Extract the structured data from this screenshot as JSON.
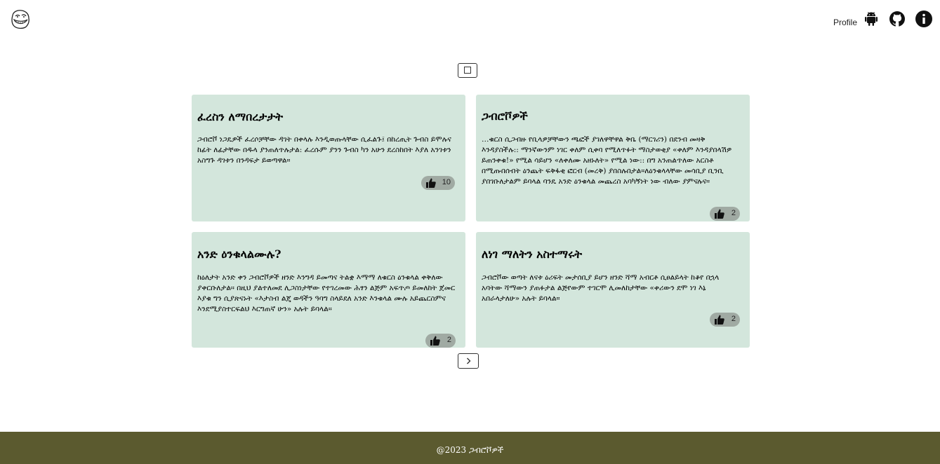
{
  "header": {
    "logo_icon": "trollface-logo-icon",
    "profile_label": "Profile",
    "icons": [
      "android-icon",
      "github-icon",
      "info-icon"
    ]
  },
  "toolbar": {
    "icon": "square-icon"
  },
  "posts": [
    {
      "title": "ፈረስን ለማበረታታት",
      "body": "ጋብሮቮ ነጋዴዎች ፈረሶቻቸው ዳገት በቀላሉ እንዲወጡላቸው ሲፈልጉ፤ በከረጢት ጉብስ ይሞሉና ከፊት ለፊታቸው በዱላ ያንጠለጥሉታል: ፈረሱም ያንን ጉብስ ካን አሁን ደረስከበት እያለ አንገቱን አስግጉ ዳገቱን በንዳፍታ ይወጣዋል።",
      "likes": "10"
    },
    {
      "title": "ጋብሮቮዎች",
      "body": "…ቁርስ ሲጋብዙ የቢላዎቻቸውን ጫፎች ያገለዋቸዋል ቅቤ (ማርገሪን) በደንብ መዛቅ እንዳያስችሉ:: ማንኛውንም ነገር ቀለም ሲቀባ የሚለጥፉት ማስታወቂያ «ቀለም እንዳያበላሽዎ ይጠንቀቁ!» የሚል ሳይሆን «ለቀለሙ አዘኑለት» የሚል ነው:: በግ አንጠልጥለው አርስቶ በሚጡበሰብት ዕንጨት ፍቅፋቂ ፎርብ (መረቅ) ያበስሉበታል።ለዕንቁላላቸው መሳቢያ ቢንቢ ያበገቡለታልም ይባላል ባንዴ አንድ ዕንቁላል መጨረስ አባካኝነት ነው ብለው ያምናሉና።",
      "likes": "2"
    },
    {
      "title": "አንድ ዕንቁላልሙሉ?",
      "body": "ከዕለታት አንድ ቀን ጋብሮቮዎች ዘንድ እንግዳ ይመጣና ትልቋ እማማ ለቁርስ ዕንቁላል ቀቅለው ያቀርቡለታል። በዚህ ያልተለመደ ሊጋስነታቸው የተገረመው ሕፃን ልጅም አፍጥጦ ይመለከት ጀመር እያቁ ግን ሲያጽናኑት «እታስብ ልጄ ወዳችን ዓባግ ስላይደለ አንድ እንቁላል ሙሉ አይጨርስምና እንደሚያስተርፍልህ እርግጠኛ ሁን» አሉት ይባላል።",
      "likes": "2"
    },
    {
      "title": "ለነገ ማለትን አስተማሩት",
      "body": "ጋብሮቮው ወጣት ለናቱ ዕሪፍት መታሰቢያ ይሆን ዘንድ ሻማ አብርቶ ሲፀልይላት ከቆየ በኋላ አባትው ሻማውን ያጠፉታል ልጅየውም ተገርሞ ሊመለከታቸው «ቀሪውን ደሞ ነገ እኔ አበራላታለሁ» አሉት ይባላል።",
      "likes": "2"
    }
  ],
  "pagination": {
    "next_icon": "chevron-right-icon"
  },
  "footer": {
    "text": "@2023 ጋብሮቮዎች"
  }
}
